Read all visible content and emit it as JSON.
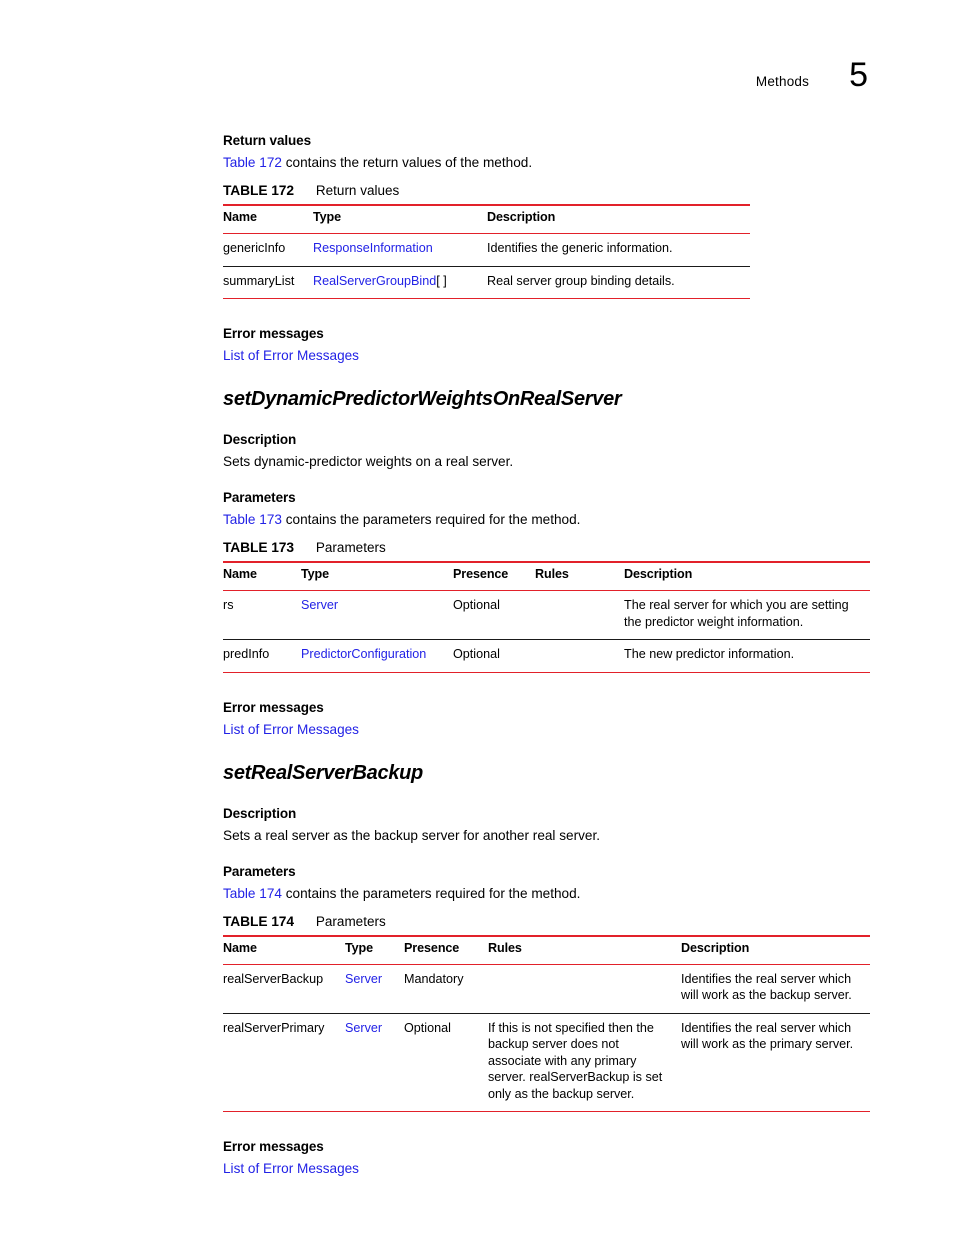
{
  "header": {
    "running_title": "Methods",
    "chapter_number": "5"
  },
  "colors": {
    "link_blue": "#2222e6",
    "table_rule_red": "#e2212a",
    "text_black": "#000000"
  },
  "sections": {
    "return_values": {
      "heading": "Return values",
      "intro_link": "Table 172",
      "intro_rest": " contains the return values of the method."
    },
    "error_messages_1": {
      "heading": "Error messages",
      "link": "List of Error Messages"
    },
    "method_1": {
      "title": "setDynamicPredictorWeightsOnRealServer",
      "description_heading": "Description",
      "description_text": "Sets dynamic-predictor weights on a real server.",
      "parameters_heading": "Parameters",
      "intro_link": "Table 173",
      "intro_rest": " contains the parameters required for the method."
    },
    "error_messages_2": {
      "heading": "Error messages",
      "link": "List of Error Messages"
    },
    "method_2": {
      "title": "setRealServerBackup",
      "description_heading": "Description",
      "description_text": "Sets a real server as the backup server for another real server.",
      "parameters_heading": "Parameters",
      "intro_link": "Table 174",
      "intro_rest": " contains the parameters required for the method."
    },
    "error_messages_3": {
      "heading": "Error messages",
      "link": "List of Error Messages"
    }
  },
  "tables": {
    "table_172": {
      "number": "TABLE 172",
      "title": "Return values",
      "columns": [
        "Name",
        "Type",
        "Description"
      ],
      "rows": [
        {
          "name": "genericInfo",
          "type": "ResponseInformation",
          "type_suffix": "",
          "description": "Identifies the generic information."
        },
        {
          "name": "summaryList",
          "type": "RealServerGroupBind",
          "type_suffix": "[ ]",
          "description": "Real server group binding details."
        }
      ]
    },
    "table_173": {
      "number": "TABLE 173",
      "title": "Parameters",
      "columns": [
        "Name",
        "Type",
        "Presence",
        "Rules",
        "Description"
      ],
      "rows": [
        {
          "name": "rs",
          "type": "Server",
          "presence": "Optional",
          "rules": "",
          "description": "The real server for which you are setting the predictor weight information."
        },
        {
          "name": "predInfo",
          "type": "PredictorConfiguration",
          "presence": "Optional",
          "rules": "",
          "description": "The new predictor information."
        }
      ]
    },
    "table_174": {
      "number": "TABLE 174",
      "title": "Parameters",
      "columns": [
        "Name",
        "Type",
        "Presence",
        "Rules",
        "Description"
      ],
      "rows": [
        {
          "name": "realServerBackup",
          "type": "Server",
          "presence": "Mandatory",
          "rules": "",
          "description": "Identifies the real server which will work as the backup server."
        },
        {
          "name": "realServerPrimary",
          "type": "Server",
          "presence": "Optional",
          "rules": "If this is not specified then the backup server does not associate with any primary server. realServerBackup is set only as the backup server.",
          "description": "Identifies the real server which will work as the primary server."
        }
      ]
    }
  }
}
